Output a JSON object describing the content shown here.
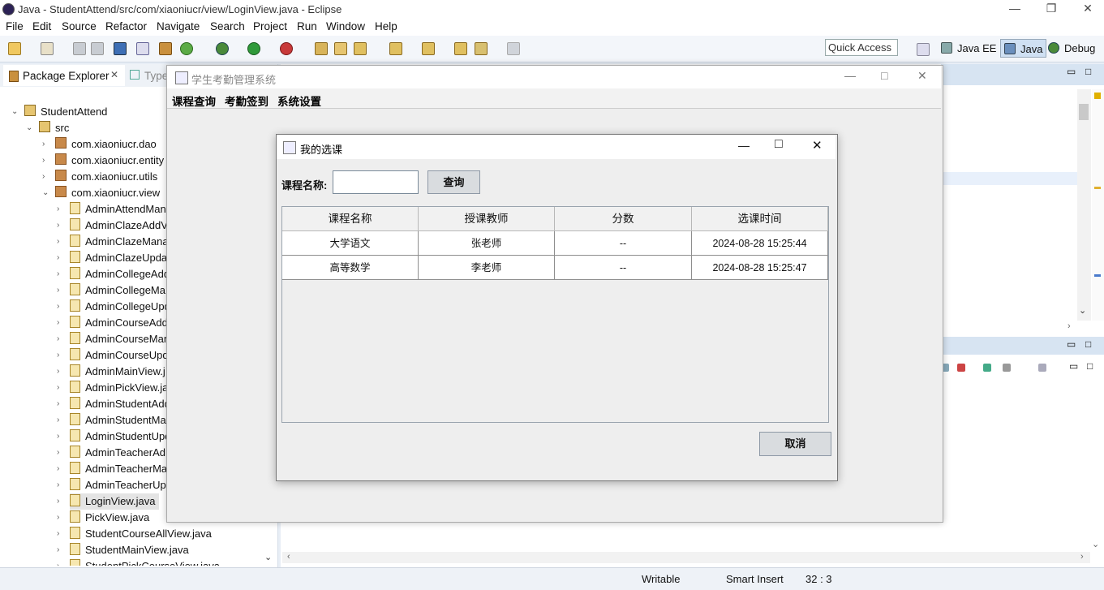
{
  "eclipse": {
    "title": "Java - StudentAttend/src/com/xiaoniucr/view/LoginView.java - Eclipse",
    "menu": [
      "File",
      "Edit",
      "Source",
      "Refactor",
      "Navigate",
      "Search",
      "Project",
      "Run",
      "Window",
      "Help"
    ],
    "quick_access": "Quick Access",
    "perspectives": [
      "Java EE",
      "Java",
      "Debug"
    ],
    "package_explorer_tab": "Package Explorer",
    "type_tab": "Type",
    "tree": {
      "project": "StudentAttend",
      "src": "src",
      "packages": [
        "com.xiaoniucr.dao",
        "com.xiaoniucr.entity",
        "com.xiaoniucr.utils",
        "com.xiaoniucr.view"
      ],
      "files": [
        "AdminAttendMan",
        "AdminClazeAddV",
        "AdminClazeMana",
        "AdminClazeUpda",
        "AdminCollegeAdd",
        "AdminCollegeMa",
        "AdminCollegeUpd",
        "AdminCourseAdd",
        "AdminCourseMan",
        "AdminCourseUpd",
        "AdminMainView.j",
        "AdminPickView.ja",
        "AdminStudentAdd",
        "AdminStudentMa",
        "AdminStudentUpd",
        "AdminTeacherAd",
        "AdminTeacherMa",
        "AdminTeacherUp",
        "LoginView.java",
        "PickView.java",
        "StudentCourseAllView.java",
        "StudentMainView.java",
        "StudentPickCourseView.java"
      ]
    },
    "status": {
      "writable": "Writable",
      "insert": "Smart Insert",
      "position": "32 : 3"
    }
  },
  "main_window": {
    "title": "学生考勤管理系统",
    "menu": [
      "课程查询",
      "考勤签到",
      "系统设置"
    ]
  },
  "dialog": {
    "title": "我的选课",
    "course_label": "课程名称:",
    "course_value": "",
    "query_button": "查询",
    "cancel_button": "取消",
    "columns": [
      "课程名称",
      "授课教师",
      "分数",
      "选课时间"
    ],
    "rows": [
      [
        "大学语文",
        "张老师",
        "--",
        "2024-08-28 15:25:44"
      ],
      [
        "高等数学",
        "李老师",
        "--",
        "2024-08-28 15:25:47"
      ]
    ]
  }
}
